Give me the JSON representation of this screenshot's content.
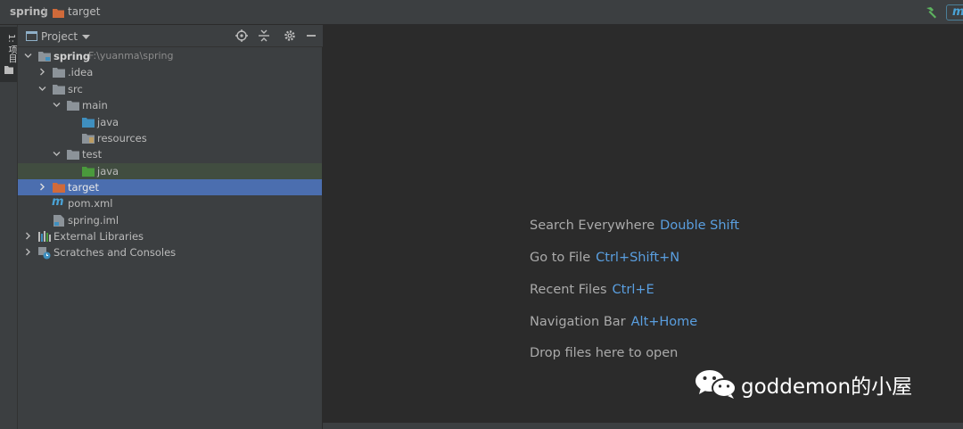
{
  "navbar": {
    "root": "spring",
    "separator": "〉",
    "current": "target",
    "hammer_icon": "build-hammer-icon",
    "maven_label": "m"
  },
  "stripe": {
    "tab_label": "1: 项目"
  },
  "panel": {
    "title": "Project",
    "tools": [
      "locate-icon",
      "collapse-all-icon",
      "settings-gear-icon",
      "hide-minus-icon"
    ]
  },
  "tree": {
    "root": {
      "label": "spring",
      "path": "F:\\yuanma\\spring"
    },
    "idea": ".idea",
    "src": "src",
    "main": "main",
    "java_main": "java",
    "resources": "resources",
    "test": "test",
    "java_test": "java",
    "target": "target",
    "pom": "pom.xml",
    "iml": "spring.iml",
    "ext_libs": "External Libraries",
    "scratches": "Scratches and Consoles"
  },
  "hints": [
    {
      "label": "Search Everywhere",
      "key": "Double Shift"
    },
    {
      "label": "Go to File",
      "key": "Ctrl+Shift+N"
    },
    {
      "label": "Recent Files",
      "key": "Ctrl+E"
    },
    {
      "label": "Navigation Bar",
      "key": "Alt+Home"
    },
    {
      "label": "Drop files here to open",
      "key": ""
    }
  ],
  "watermark": {
    "text": "goddemon的小屋"
  },
  "colors": {
    "folder_gray": "#8c9399",
    "folder_blue": "#3f8fbf",
    "folder_green": "#4a9a3c",
    "folder_orange": "#d06a3a",
    "accent_key": "#5a9fe0",
    "selection": "#4b6eaf"
  }
}
